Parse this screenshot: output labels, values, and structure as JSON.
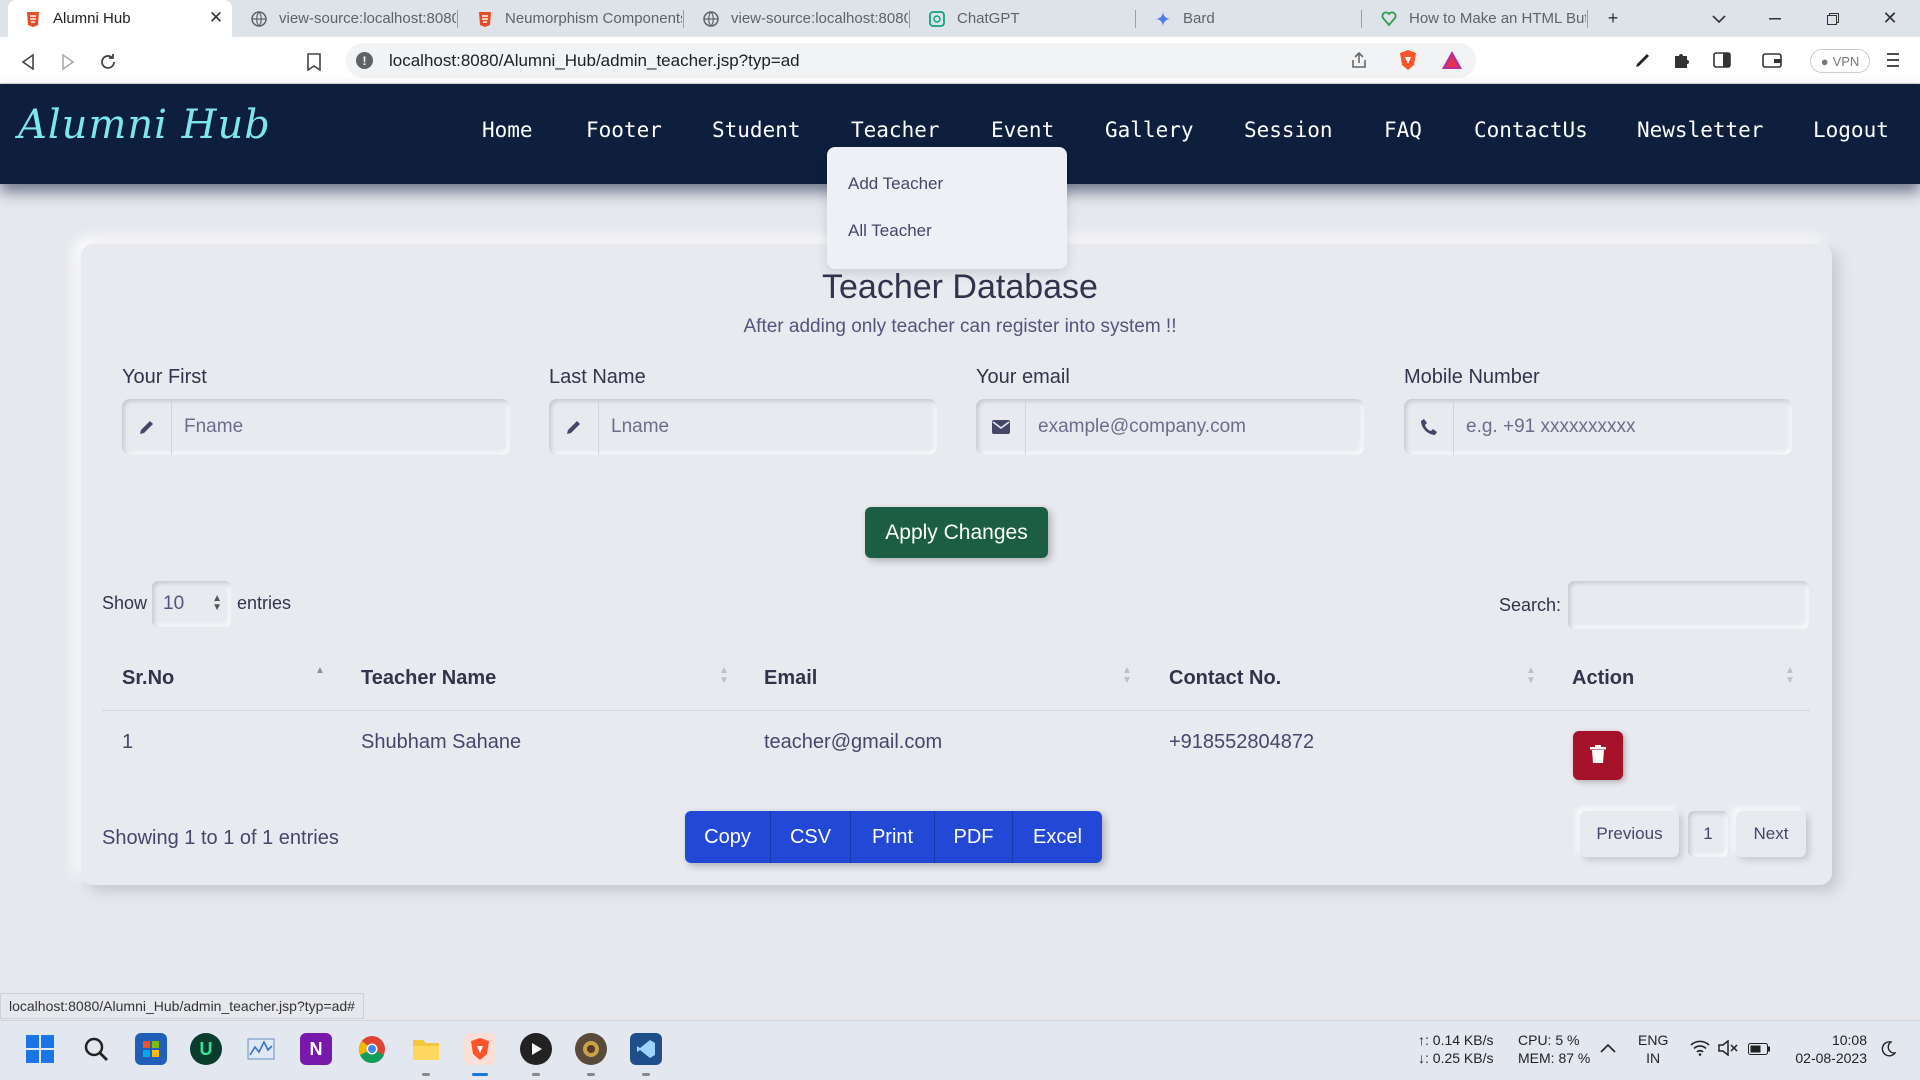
{
  "browser": {
    "tabs": [
      {
        "title": "Alumni Hub",
        "active": true
      },
      {
        "title": "view-source:localhost:8080"
      },
      {
        "title": "Neumorphism Components"
      },
      {
        "title": "view-source:localhost:8080"
      },
      {
        "title": "ChatGPT"
      },
      {
        "title": "Bard"
      },
      {
        "title": "How to Make an HTML Butt"
      }
    ],
    "url": "localhost:8080/Alumni_Hub/admin_teacher.jsp?typ=ad",
    "vpn_label": "VPN"
  },
  "site": {
    "logo": "Alumni Hub",
    "nav": [
      "Home",
      "Footer",
      "Student",
      "Teacher",
      "Event",
      "Gallery",
      "Session",
      "FAQ",
      "ContactUs",
      "Newsletter",
      "Logout"
    ],
    "dropdown": [
      "Add Teacher",
      "All Teacher"
    ]
  },
  "page": {
    "title": "Teacher Database",
    "subtitle": "After adding only teacher can register into system !!"
  },
  "form": {
    "fields": [
      {
        "label": "Your First",
        "placeholder": "Fname",
        "icon": "pencil-icon"
      },
      {
        "label": "Last Name",
        "placeholder": "Lname",
        "icon": "pencil-icon"
      },
      {
        "label": "Your email",
        "placeholder": "example@company.com",
        "icon": "envelope-icon"
      },
      {
        "label": "Mobile Number",
        "placeholder": "e.g. +91 xxxxxxxxxx",
        "icon": "phone-icon"
      }
    ],
    "apply_label": "Apply Changes"
  },
  "table": {
    "show_label": "Show",
    "entries_value": "10",
    "entries_label": "entries",
    "search_label": "Search:",
    "columns": [
      "Sr.No",
      "Teacher Name",
      "Email",
      "Contact No.",
      "Action"
    ],
    "rows": [
      {
        "srno": "1",
        "name": "Shubham Sahane",
        "email": "teacher@gmail.com",
        "contact": "+918552804872"
      }
    ],
    "info": "Showing 1 to 1 of 1 entries",
    "export_buttons": [
      "Copy",
      "CSV",
      "Print",
      "PDF",
      "Excel"
    ],
    "pagination": {
      "prev": "Previous",
      "page": "1",
      "next": "Next"
    }
  },
  "statusbar": {
    "url": "localhost:8080/Alumni_Hub/admin_teacher.jsp?typ=ad#"
  },
  "taskbar": {
    "net_up": "↑: 0.14 KB/s",
    "net_down": "↓: 0.25 KB/s",
    "cpu": "CPU: 5 %",
    "mem": "MEM: 87 %",
    "lang1": "ENG",
    "lang2": "IN",
    "time": "10:08",
    "date": "02-08-2023"
  },
  "colors": {
    "nav_bg": "#0e1e3d",
    "logo": "#7fe6ee",
    "apply": "#1c5e44",
    "delete": "#a5122a",
    "export": "#2348d6"
  }
}
